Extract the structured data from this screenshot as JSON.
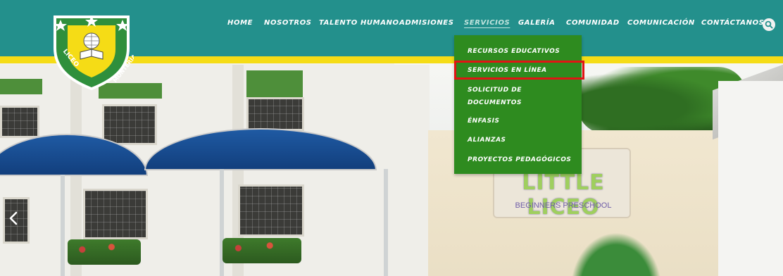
{
  "logo": {
    "text_left": "LICEO",
    "text_right": "MONTERÍA"
  },
  "nav": {
    "items": [
      {
        "label": "HOME"
      },
      {
        "label": "NOSOTROS"
      },
      {
        "label": "TALENTO HUMANO"
      },
      {
        "label": "ADMISIONES"
      },
      {
        "label": "SERVICIOS",
        "active": true
      },
      {
        "label": "GALERÍA"
      },
      {
        "label": "COMUNIDAD"
      },
      {
        "label": "COMUNICACIÓN"
      },
      {
        "label": "CONTÁCTANOS"
      }
    ],
    "search_icon": "search-icon"
  },
  "dropdown": {
    "items": [
      {
        "label": "RECURSOS EDUCATIVOS"
      },
      {
        "label": "SERVICIOS EN LÍNEA",
        "highlighted": true
      },
      {
        "label": "SOLICITUD DE"
      },
      {
        "label": "DOCUMENTOS"
      },
      {
        "label": "ÉNFASIS"
      },
      {
        "label": "ALIANZAS"
      },
      {
        "label": "PROYECTOS PEDAGÓGICOS"
      }
    ]
  },
  "hero": {
    "sign_title": "LITTLE LICEO",
    "sign_subtitle": "BEGINNERS PRESCHOOL"
  },
  "colors": {
    "header": "#23908c",
    "stripe": "#f5dc16",
    "dropdown": "#2e8b1f",
    "highlight": "#e01414"
  }
}
